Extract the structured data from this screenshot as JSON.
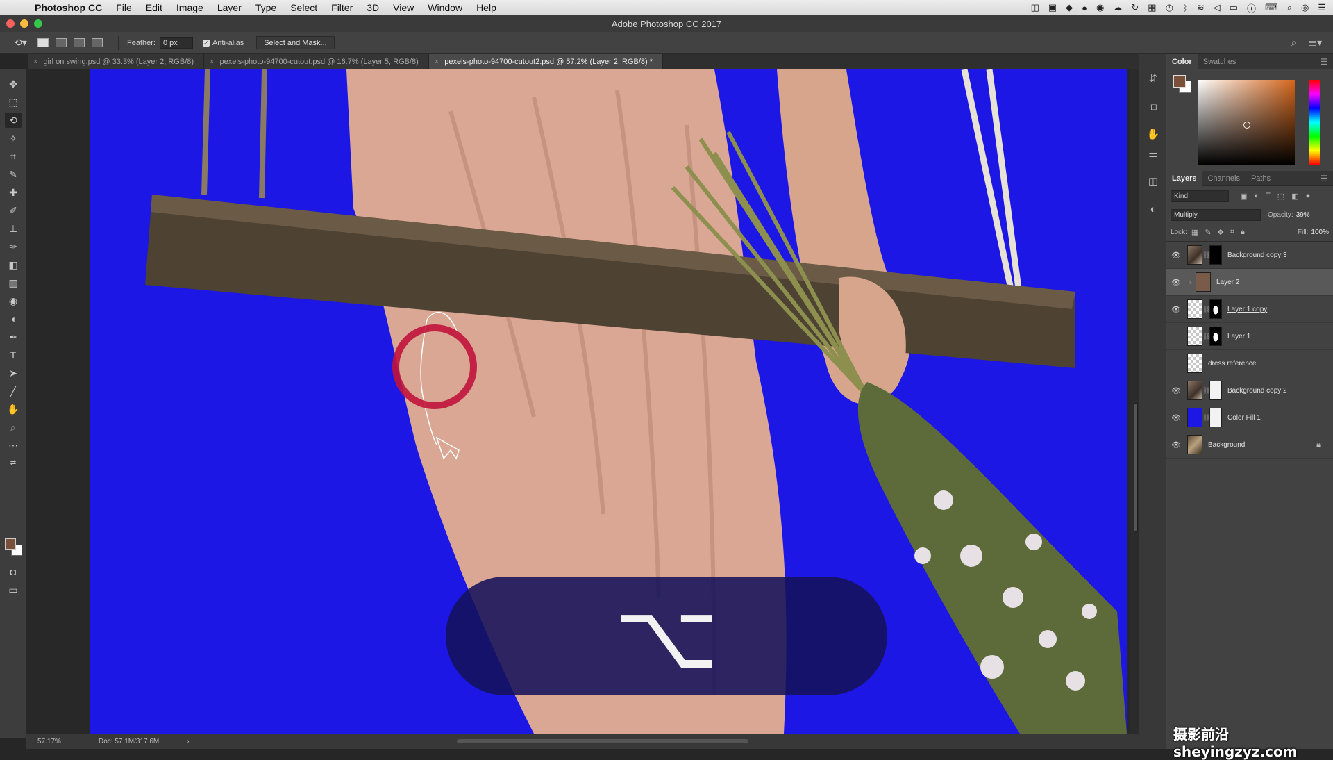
{
  "menubar": {
    "app": "Photoshop CC",
    "items": [
      "File",
      "Edit",
      "Image",
      "Layer",
      "Type",
      "Select",
      "Filter",
      "3D",
      "View",
      "Window",
      "Help"
    ]
  },
  "window": {
    "title": "Adobe Photoshop CC 2017"
  },
  "options": {
    "feather_label": "Feather:",
    "feather_value": "0 px",
    "antialias_label": "Anti-alias",
    "antialias_checked": true,
    "select_mask_button": "Select and Mask..."
  },
  "tabs": [
    {
      "label": "girl on swing.psd @ 33.3% (Layer 2, RGB/8)",
      "active": false
    },
    {
      "label": "pexels-photo-94700-cutout.psd @ 16.7% (Layer 5, RGB/8)",
      "active": false
    },
    {
      "label": "pexels-photo-94700-cutout2.psd @ 57.2% (Layer 2, RGB/8) *",
      "active": true
    }
  ],
  "key_overlay": {
    "symbol": "⌥",
    "meaning": "option-key"
  },
  "status": {
    "zoom": "57.17%",
    "doc": "Doc: 57.1M/317.6M"
  },
  "color_panel": {
    "tabs": [
      "Color",
      "Swatches"
    ],
    "active_tab": "Color",
    "foreground": "#7a5038",
    "background": "#ffffff"
  },
  "layers_panel": {
    "tabs": [
      "Layers",
      "Channels",
      "Paths"
    ],
    "active_tab": "Layers",
    "kind": "Kind",
    "blend_mode": "Multiply",
    "opacity_label": "Opacity:",
    "opacity": "39%",
    "lock_label": "Lock:",
    "fill_label": "Fill:",
    "fill": "100%",
    "layers": [
      {
        "name": "Background copy 3",
        "visible": true,
        "selected": false
      },
      {
        "name": "Layer 2",
        "visible": true,
        "selected": true
      },
      {
        "name": "Layer 1 copy",
        "visible": true,
        "selected": false
      },
      {
        "name": "Layer 1",
        "visible": false,
        "selected": false
      },
      {
        "name": "dress reference",
        "visible": false,
        "selected": false
      },
      {
        "name": "Background copy 2",
        "visible": true,
        "selected": false
      },
      {
        "name": "Color Fill 1",
        "visible": true,
        "selected": false
      },
      {
        "name": "Background",
        "visible": true,
        "selected": false
      }
    ]
  },
  "colors": {
    "canvas_fill": "#1d17e6",
    "accent": "#7a5038"
  },
  "watermark": "摄影前沿 sheyingzyz.com"
}
